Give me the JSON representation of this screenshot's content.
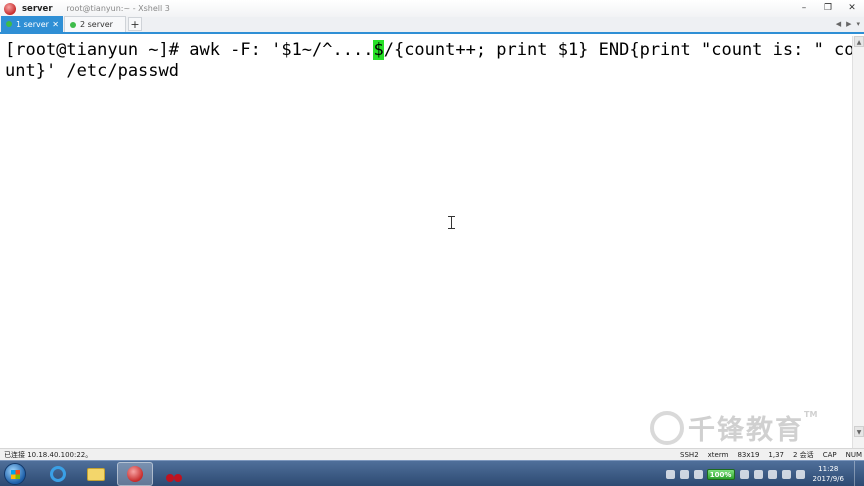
{
  "window": {
    "title": "server",
    "subtitle": "root@tianyun:~ - Xshell 3",
    "controls": {
      "minimize": "–",
      "maximize": "❐",
      "close": "✕"
    }
  },
  "tabs": [
    {
      "label": "1 server",
      "active": true,
      "close": "✕"
    },
    {
      "label": "2 server",
      "active": false
    }
  ],
  "tab_add_label": "+",
  "tab_nav": {
    "prev": "◀",
    "next": "▶",
    "menu": "▾"
  },
  "terminal": {
    "line1_before_cursor": "[root@tianyun ~]# awk -F: '$1~/^....",
    "cursor_char": "$",
    "line1_after_cursor": "/{count++; print $1} END{print \"count is: \" co",
    "line2": "unt}' /etc/passwd",
    "cursor_color": "#27e027"
  },
  "scrollbar": {
    "up": "▲",
    "down": "▼"
  },
  "watermark": {
    "text": "千锋教育",
    "tm": "TM"
  },
  "statusbar": {
    "connection": "已连接 10.18.40.100:22。",
    "protocol": "SSH2",
    "term_type": "xterm",
    "size": "83x19",
    "position": "1,37",
    "sessions": "2 会话",
    "caps": "CAP",
    "num": "NUM"
  },
  "taskbar": {
    "battery_label": "100%",
    "time": "11:28",
    "date": "2017/9/6"
  }
}
